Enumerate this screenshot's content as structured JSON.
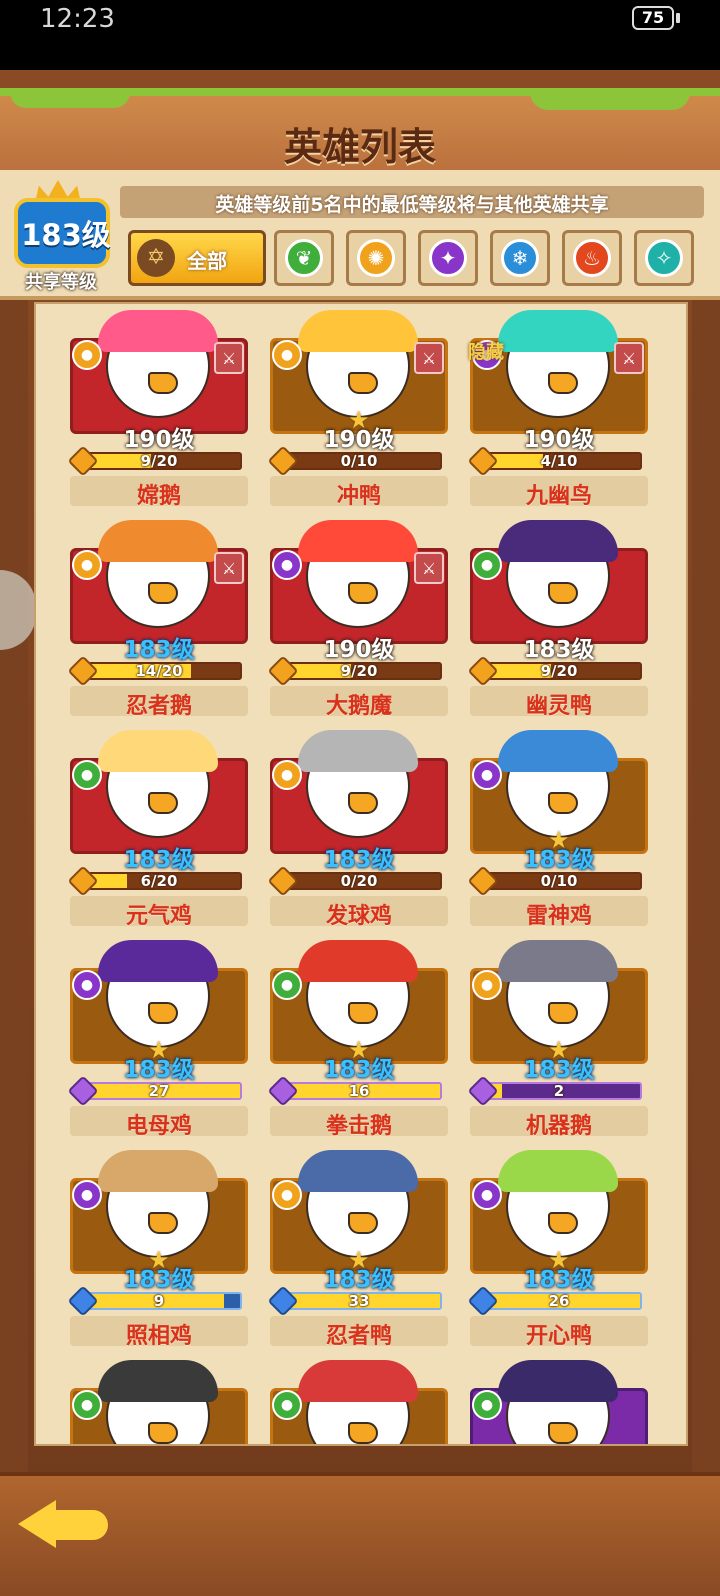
{
  "status_bar": {
    "time": "12:23",
    "battery": "75"
  },
  "title": "英雄列表",
  "header": {
    "shared_level_value": "183级",
    "shared_level_label": "共享等级",
    "info_text": "英雄等级前5名中的最低等级将与其他英雄共享",
    "filter_all_label": "全部",
    "filters": [
      {
        "icon": "nature-icon",
        "color": "#3fae3a"
      },
      {
        "icon": "sun-icon",
        "color": "#f0a21c"
      },
      {
        "icon": "shadow-icon",
        "color": "#8a35c9"
      },
      {
        "icon": "ice-icon",
        "color": "#2a8ed8"
      },
      {
        "icon": "fire-icon",
        "color": "#e2471e"
      },
      {
        "icon": "storm-icon",
        "color": "#1fb1a8"
      }
    ]
  },
  "heroes": [
    {
      "name": "嫦鹅",
      "level": "190级",
      "progress": "9/20",
      "fraction": 0.45,
      "frame": "red",
      "element_color": "#f0a21c",
      "role": true,
      "star": false,
      "level_color": "white",
      "bar": "gold",
      "hair_color": "#ff5a8a"
    },
    {
      "name": "冲鸭",
      "level": "190级",
      "progress": "0/10",
      "fraction": 0,
      "frame": "orange",
      "element_color": "#f0a21c",
      "role": true,
      "star": true,
      "level_color": "white",
      "bar": "gold",
      "hair_color": "#ffc43a"
    },
    {
      "name": "九幽鸟",
      "level": "190级",
      "progress": "4/10",
      "fraction": 0.4,
      "frame": "orange",
      "element_color": "#8a35c9",
      "role": true,
      "star": false,
      "level_color": "white",
      "bar": "gold",
      "hidden_label": "隐藏",
      "hair_color": "#33d4c0"
    },
    {
      "name": "忍者鹅",
      "level": "183级",
      "progress": "14/20",
      "fraction": 0.7,
      "frame": "red",
      "element_color": "#f0a21c",
      "role": true,
      "star": false,
      "level_color": "blue",
      "bar": "gold",
      "hair_color": "#f08a2e"
    },
    {
      "name": "大鹅魔",
      "level": "190级",
      "progress": "9/20",
      "fraction": 0.45,
      "frame": "red",
      "element_color": "#8a35c9",
      "role": true,
      "star": false,
      "level_color": "white",
      "bar": "gold",
      "hair_color": "#ff4a3a"
    },
    {
      "name": "幽灵鸭",
      "level": "183级",
      "progress": "9/20",
      "fraction": 0.45,
      "frame": "red",
      "element_color": "#3fae3a",
      "role": false,
      "star": false,
      "level_color": "white",
      "bar": "gold",
      "hair_color": "#4a2a7a"
    },
    {
      "name": "元气鸡",
      "level": "183级",
      "progress": "6/20",
      "fraction": 0.3,
      "frame": "red",
      "element_color": "#3fae3a",
      "role": false,
      "star": false,
      "level_color": "blue",
      "bar": "gold",
      "hair_color": "#ffd87a"
    },
    {
      "name": "发球鸡",
      "level": "183级",
      "progress": "0/20",
      "fraction": 0,
      "frame": "red",
      "element_color": "#f0a21c",
      "role": false,
      "star": false,
      "level_color": "blue",
      "bar": "gold",
      "hair_color": "#b5b5b5"
    },
    {
      "name": "雷神鸡",
      "level": "183级",
      "progress": "0/10",
      "fraction": 0,
      "frame": "orange",
      "element_color": "#8a35c9",
      "role": false,
      "star": true,
      "level_color": "blue",
      "bar": "gold",
      "hair_color": "#3a8ad8"
    },
    {
      "name": "电母鸡",
      "level": "183级",
      "progress": "27",
      "fraction": 1,
      "frame": "orange",
      "element_color": "#8a35c9",
      "role": false,
      "star": true,
      "level_color": "blue",
      "bar": "purple",
      "hair_color": "#5a2a9a"
    },
    {
      "name": "拳击鹅",
      "level": "183级",
      "progress": "16",
      "fraction": 1,
      "frame": "orange",
      "element_color": "#3fae3a",
      "role": false,
      "star": true,
      "level_color": "blue",
      "bar": "purple",
      "hair_color": "#e03a2a"
    },
    {
      "name": "机器鹅",
      "level": "183级",
      "progress": "2",
      "fraction": 0.15,
      "frame": "orange",
      "element_color": "#f0a21c",
      "role": false,
      "star": true,
      "level_color": "blue",
      "bar": "purple",
      "hair_color": "#7a7a8a"
    },
    {
      "name": "照相鸡",
      "level": "183级",
      "progress": "9",
      "fraction": 0.9,
      "frame": "orange",
      "element_color": "#8a35c9",
      "role": false,
      "star": true,
      "level_color": "blue",
      "bar": "blue",
      "hair_color": "#d8a86a"
    },
    {
      "name": "忍者鸭",
      "level": "183级",
      "progress": "33",
      "fraction": 1,
      "frame": "orange",
      "element_color": "#f0a21c",
      "role": false,
      "star": true,
      "level_color": "blue",
      "bar": "blue",
      "hair_color": "#4a6aa8"
    },
    {
      "name": "开心鸭",
      "level": "183级",
      "progress": "26",
      "fraction": 1,
      "frame": "orange",
      "element_color": "#8a35c9",
      "role": false,
      "star": true,
      "level_color": "blue",
      "bar": "blue",
      "hair_color": "#9ad84a"
    },
    {
      "name": "",
      "level": "",
      "progress": "",
      "fraction": 0,
      "frame": "orange",
      "element_color": "#3fae3a",
      "role": false,
      "star": false,
      "level_color": "blue",
      "bar": "none",
      "hair_color": "#3a3a3a"
    },
    {
      "name": "",
      "level": "",
      "progress": "",
      "fraction": 0,
      "frame": "orange",
      "element_color": "#3fae3a",
      "role": false,
      "star": false,
      "level_color": "blue",
      "bar": "none",
      "hair_color": "#d83a3a"
    },
    {
      "name": "",
      "level": "",
      "progress": "",
      "fraction": 0,
      "frame": "purple",
      "element_color": "#3fae3a",
      "role": false,
      "star": false,
      "level_color": "blue",
      "bar": "none",
      "hair_color": "#3a2a6a"
    }
  ]
}
